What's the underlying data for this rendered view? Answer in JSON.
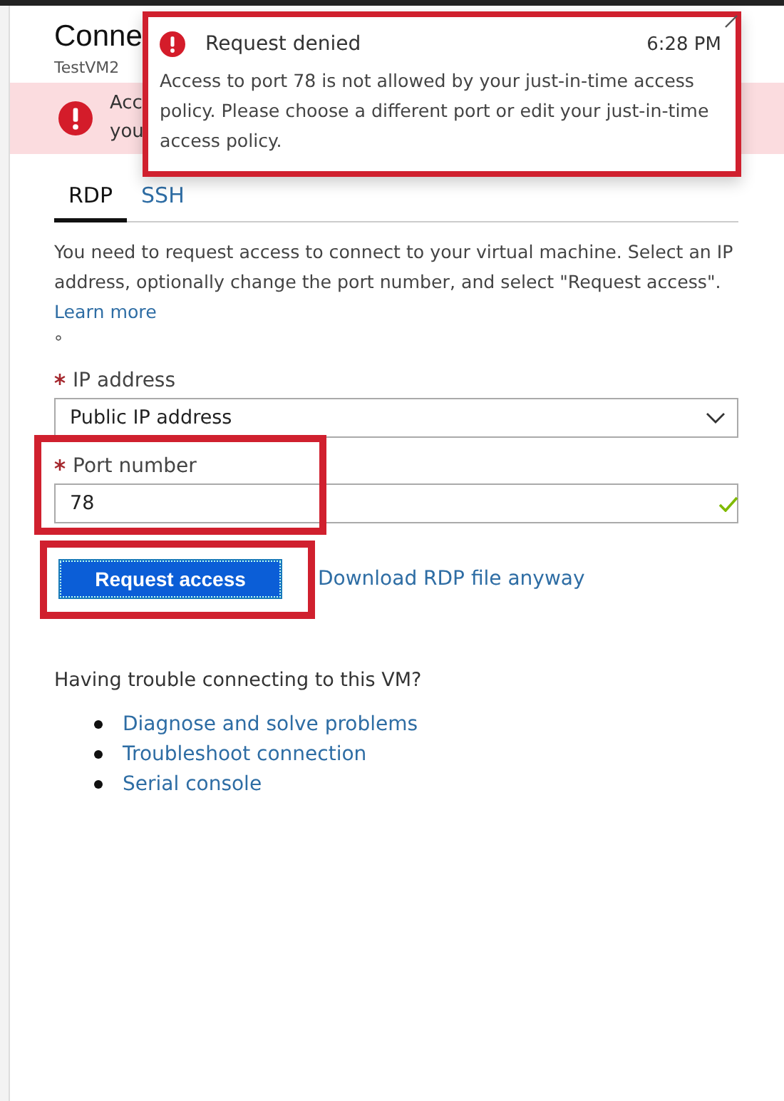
{
  "blade": {
    "title": "Conne",
    "subtitle": "TestVM2"
  },
  "banner": {
    "lines": [
      "Acc",
      "you"
    ]
  },
  "toast": {
    "title": "Request denied",
    "time": "6:28 PM",
    "message": "Access to port 78 is not allowed by your just-in-time access policy. Please choose a different port or edit your just-in-time access policy.",
    "highlighted": true
  },
  "tabs": [
    {
      "label": "RDP",
      "selected": true
    },
    {
      "label": "SSH",
      "selected": false
    }
  ],
  "description": {
    "text": "You need to request access to connect to your virtual machine. Select an IP address, optionally change the port number, and select \"Request access\".",
    "link": "Learn more",
    "note": "°"
  },
  "ip_address": {
    "label": "IP address",
    "required": true,
    "value": "Public IP address"
  },
  "port_number": {
    "label": "Port number",
    "required": true,
    "value": "78",
    "valid": true,
    "highlighted": true
  },
  "request_button": {
    "label": "Request access",
    "highlighted": true
  },
  "download_link": "Download RDP file anyway",
  "help": {
    "question": "Having trouble connecting to this VM?",
    "links": [
      "Diagnose and solve problems",
      "Troubleshoot connection",
      "Serial console"
    ]
  }
}
